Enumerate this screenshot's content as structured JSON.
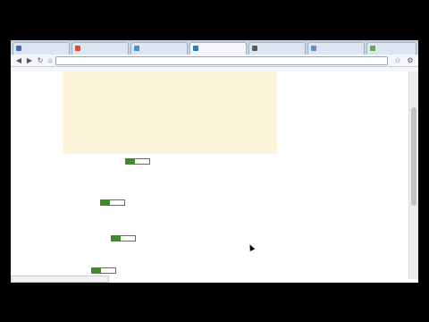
{
  "browser": {
    "tabs": [
      {
        "label": "",
        "color": "#3b6fb6",
        "active": false
      },
      {
        "label": "",
        "color": "#e34a33",
        "active": false
      },
      {
        "label": "",
        "color": "#4a90d9",
        "active": false
      },
      {
        "label": "",
        "color": "#2a7bd4",
        "active": true
      },
      {
        "label": "",
        "color": "#5a5a5a",
        "active": false
      },
      {
        "label": "",
        "color": "#6c8ebf",
        "active": false
      },
      {
        "label": "",
        "color": "#6aa84f",
        "active": false
      }
    ],
    "url": "",
    "status_url": ""
  },
  "ads_top": [
    {
      "title": "",
      "url": "",
      "snippet": [
        "",
        ""
      ]
    },
    {
      "title": "",
      "url": "",
      "snippet": [
        "",
        ""
      ]
    },
    {
      "title": "",
      "url": "",
      "snippet": [
        "",
        ""
      ]
    }
  ],
  "results": [
    {
      "title": "",
      "url": "",
      "snippet": [
        "",
        "",
        "",
        ""
      ]
    },
    {
      "title": "",
      "url": "",
      "snippet": [
        "",
        "",
        "",
        ""
      ]
    },
    {
      "title": "",
      "url": "",
      "snippet": [
        "",
        "",
        ""
      ]
    },
    {
      "title": "",
      "url": "",
      "snippet": [
        "",
        ""
      ]
    }
  ],
  "sidebar_ads": [
    {
      "title": "",
      "url": "",
      "snippet": [
        "",
        ""
      ]
    },
    {
      "title": "",
      "url": "",
      "snippet": [
        "",
        ""
      ]
    },
    {
      "title": "",
      "url": "",
      "snippet": [
        "",
        ""
      ]
    },
    {
      "title": "",
      "url": "",
      "snippet": [
        "",
        ""
      ]
    },
    {
      "title": "",
      "url": "",
      "snippet": [
        "",
        ""
      ]
    },
    {
      "title": "",
      "url": "",
      "snippet": [
        "",
        ""
      ]
    },
    {
      "title": "",
      "url": "",
      "snippet": [
        "",
        ""
      ]
    },
    {
      "title": "",
      "url": "",
      "snippet": [
        "",
        ""
      ]
    },
    {
      "title": "",
      "url": "",
      "snippet": [
        "",
        ""
      ]
    },
    {
      "title": "",
      "url": "",
      "snippet": [
        "",
        ""
      ]
    }
  ]
}
